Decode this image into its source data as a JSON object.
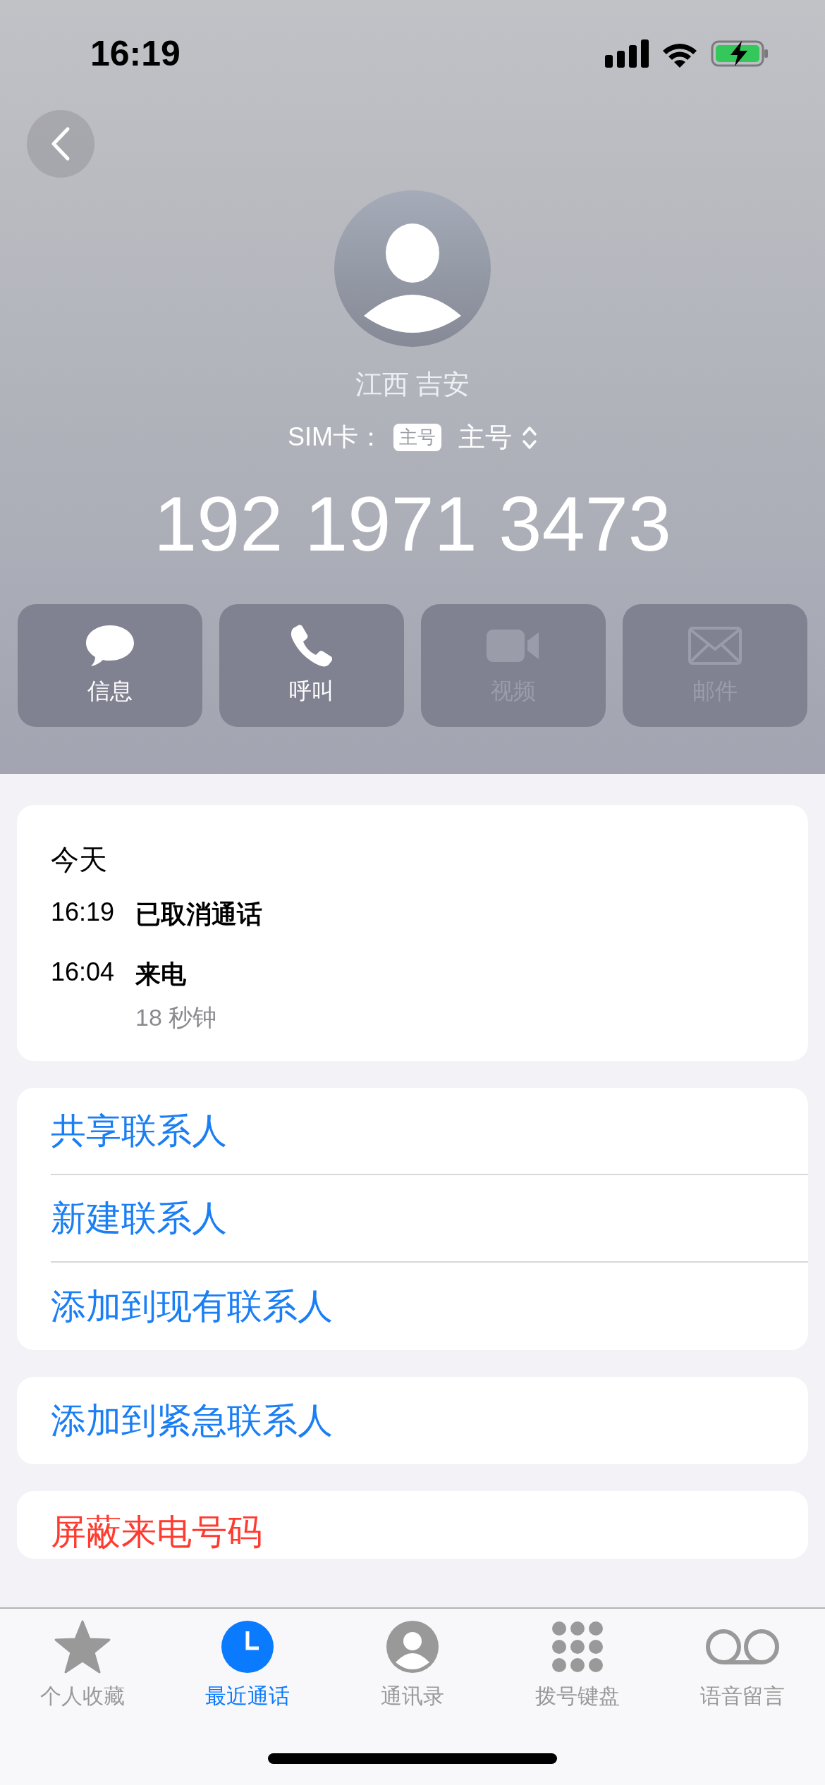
{
  "status_bar": {
    "time": "16:19"
  },
  "header": {
    "location": "江西 吉安",
    "sim_label": "SIM卡：",
    "sim_badge": "主号",
    "sim_value": "主号",
    "phone_number": "192 1971 3473"
  },
  "actions": [
    {
      "kind": "message",
      "label": "信息",
      "disabled": false
    },
    {
      "kind": "call",
      "label": "呼叫",
      "disabled": false
    },
    {
      "kind": "video",
      "label": "视频",
      "disabled": true
    },
    {
      "kind": "mail",
      "label": "邮件",
      "disabled": true
    }
  ],
  "history": {
    "day": "今天",
    "entries": [
      {
        "time": "16:19",
        "type": "已取消通话"
      },
      {
        "time": "16:04",
        "type": "来电",
        "duration": "18 秒钟"
      }
    ]
  },
  "contact_actions": [
    "共享联系人",
    "新建联系人",
    "添加到现有联系人"
  ],
  "emergency_action": "添加到紧急联系人",
  "block_action": "屏蔽来电号码",
  "tabs": [
    {
      "kind": "favorites",
      "label": "个人收藏",
      "selected": false
    },
    {
      "kind": "recents",
      "label": "最近通话",
      "selected": true
    },
    {
      "kind": "contacts",
      "label": "通讯录",
      "selected": false
    },
    {
      "kind": "keypad",
      "label": "拨号键盘",
      "selected": false
    },
    {
      "kind": "voicemail",
      "label": "语音留言",
      "selected": false
    }
  ]
}
